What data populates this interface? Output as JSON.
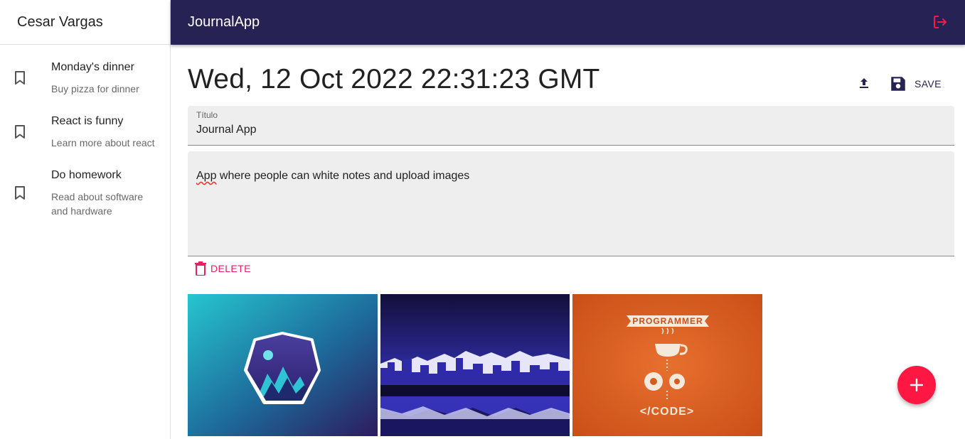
{
  "sidebar": {
    "user_name": "Cesar Vargas",
    "notes": [
      {
        "title": "Monday's dinner",
        "body": "Buy pizza for dinner"
      },
      {
        "title": "React is funny",
        "body": "Learn more about react"
      },
      {
        "title": "Do homework",
        "body": "Read about software and hardware"
      }
    ]
  },
  "appbar": {
    "title": "JournalApp",
    "logout_icon": "logout-icon"
  },
  "note": {
    "date": "Wed, 12 Oct 2022 22:31:23 GMT",
    "save_label": "SAVE",
    "title_label": "Título",
    "title_value": "Journal App",
    "body_first_word": "App",
    "body_rest": " where people can white notes and upload images",
    "delete_label": "DELETE"
  },
  "gallery": [
    {
      "name": "hexagon-mountains-image"
    },
    {
      "name": "city-skyline-reflection-image"
    },
    {
      "name": "programmer-code-image"
    }
  ],
  "colors": {
    "appbar": "#262254",
    "accent": "#ff1744",
    "delete": "#e91e63"
  }
}
